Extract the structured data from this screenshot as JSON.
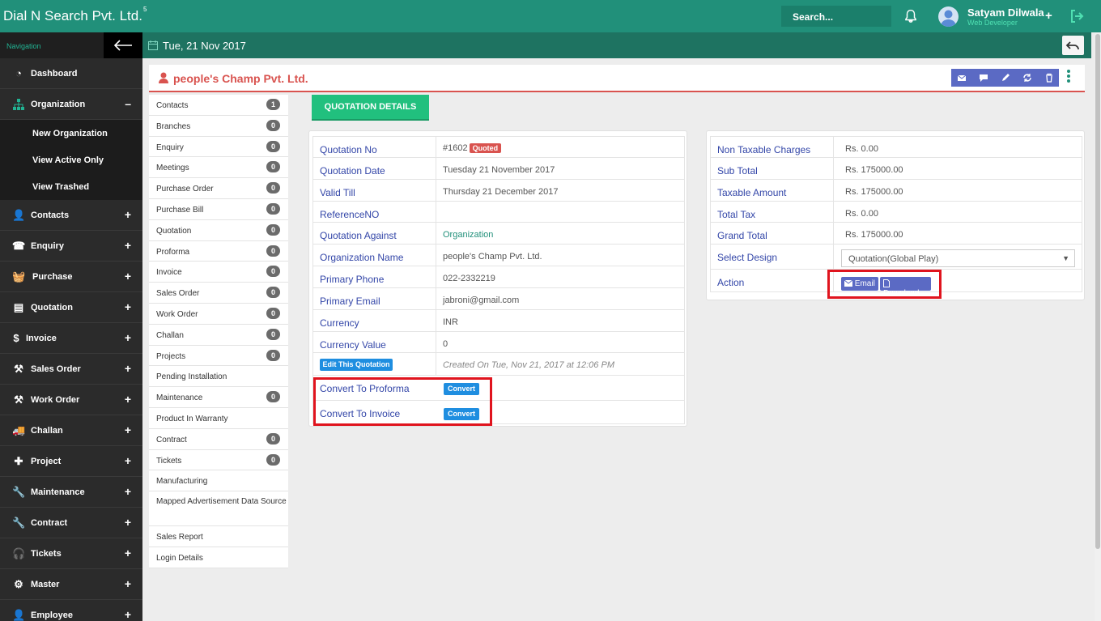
{
  "app": {
    "brand": "Dial N Search Pvt. Ltd.",
    "brand_sup": "5"
  },
  "header": {
    "search_placeholder": "Search...",
    "user_name": "Satyam Dilwala",
    "user_role": "Web Developer",
    "plus": "+"
  },
  "sidebar": {
    "nav_label": "Navigation",
    "items": [
      {
        "label": "Dashboard",
        "icon": "dashboard-icon",
        "pm": ""
      },
      {
        "label": "Organization",
        "icon": "sitemap-icon",
        "pm": "–"
      },
      {
        "label": "Contacts",
        "icon": "user-icon",
        "pm": "+"
      },
      {
        "label": "Enquiry",
        "icon": "phone-icon",
        "pm": "+"
      },
      {
        "label": "Purchase",
        "icon": "basket-icon",
        "pm": "+"
      },
      {
        "label": "Quotation",
        "icon": "document-icon",
        "pm": "+"
      },
      {
        "label": "Invoice",
        "icon": "dollar-icon",
        "pm": "+"
      },
      {
        "label": "Sales Order",
        "icon": "gavel-icon",
        "pm": "+"
      },
      {
        "label": "Work Order",
        "icon": "gavel-icon",
        "pm": "+"
      },
      {
        "label": "Challan",
        "icon": "truck-icon",
        "pm": "+"
      },
      {
        "label": "Project",
        "icon": "puzzle-icon",
        "pm": "+"
      },
      {
        "label": "Maintenance",
        "icon": "wrench-icon",
        "pm": "+"
      },
      {
        "label": "Contract",
        "icon": "wrench-icon",
        "pm": "+"
      },
      {
        "label": "Tickets",
        "icon": "headset-icon",
        "pm": "+"
      },
      {
        "label": "Master",
        "icon": "cogs-icon",
        "pm": "+"
      },
      {
        "label": "Employee",
        "icon": "user-icon",
        "pm": "+"
      }
    ],
    "sub_items": [
      "New Organization",
      "View Active Only",
      "View Trashed"
    ]
  },
  "datebar": {
    "date": "Tue, 21 Nov 2017"
  },
  "organization": {
    "title": "people's Champ Pvt. Ltd."
  },
  "side_list": [
    {
      "label": "Contacts",
      "count": "1"
    },
    {
      "label": "Branches",
      "count": "0"
    },
    {
      "label": "Enquiry",
      "count": "0"
    },
    {
      "label": "Meetings",
      "count": "0"
    },
    {
      "label": "Purchase Order",
      "count": "0"
    },
    {
      "label": "Purchase Bill",
      "count": "0"
    },
    {
      "label": "Quotation",
      "count": "0"
    },
    {
      "label": "Proforma",
      "count": "0"
    },
    {
      "label": "Invoice",
      "count": "0"
    },
    {
      "label": "Sales Order",
      "count": "0"
    },
    {
      "label": "Work Order",
      "count": "0"
    },
    {
      "label": "Challan",
      "count": "0"
    },
    {
      "label": "Projects",
      "count": "0"
    },
    {
      "label": "Pending Installation",
      "count": ""
    },
    {
      "label": "Maintenance",
      "count": "0"
    },
    {
      "label": "Product In Warranty",
      "count": ""
    },
    {
      "label": "Contract",
      "count": "0"
    },
    {
      "label": "Tickets",
      "count": "0"
    },
    {
      "label": "Manufacturing",
      "count": ""
    },
    {
      "label": "Mapped Advertisement Data Source",
      "count": ""
    },
    {
      "label": "Sales Report",
      "count": ""
    },
    {
      "label": "Login Details",
      "count": ""
    }
  ],
  "tab": {
    "label": "QUOTATION DETAILS"
  },
  "quotation": {
    "rows": [
      {
        "label": "Quotation No",
        "value": "#1602"
      },
      {
        "label": "Quotation Date",
        "value": "Tuesday 21 November 2017"
      },
      {
        "label": "Valid Till",
        "value": "Thursday 21 December 2017"
      },
      {
        "label": "ReferenceNO",
        "value": ""
      },
      {
        "label": "Quotation Against",
        "value": "Organization"
      },
      {
        "label": "Organization Name",
        "value": "people's Champ Pvt. Ltd."
      },
      {
        "label": "Primary Phone",
        "value": "022-2332219"
      },
      {
        "label": "Primary Email",
        "value": "jabroni@gmail.com"
      },
      {
        "label": "Currency",
        "value": "INR"
      },
      {
        "label": "Currency Value",
        "value": "0"
      }
    ],
    "status_badge": "Quoted",
    "edit_button": "Edit This Quotation",
    "created_note": "Created On Tue, Nov 21, 2017 at 12:06 PM",
    "convert_proforma_label": "Convert To Proforma",
    "convert_invoice_label": "Convert To Invoice",
    "convert_button": "Convert"
  },
  "summary": {
    "rows": [
      {
        "label": "Non Taxable Charges",
        "value": "Rs. 0.00"
      },
      {
        "label": "Sub Total",
        "value": "Rs. 175000.00"
      },
      {
        "label": "Taxable Amount",
        "value": "Rs. 175000.00"
      },
      {
        "label": "Total Tax",
        "value": "Rs. 0.00"
      },
      {
        "label": "Grand Total",
        "value": "Rs. 175000.00"
      }
    ],
    "select_design_label": "Select Design",
    "select_design_value": "Quotation(Global Play)",
    "action_label": "Action",
    "email_button": "Email",
    "download_button": "Download"
  },
  "colors": {
    "brand": "#21907a",
    "accent_red": "#d9534f",
    "link_blue": "#3346a8",
    "button_blue": "#1f8ee0",
    "highlight": "#e0141e"
  }
}
